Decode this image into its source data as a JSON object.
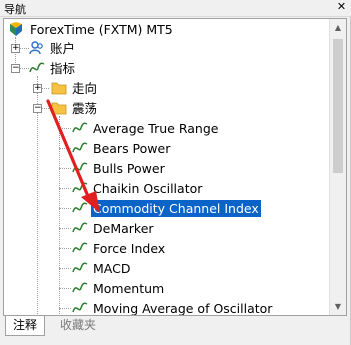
{
  "window": {
    "title": "导航"
  },
  "tree": {
    "root": {
      "label": "ForexTime (FXTM) MT5"
    },
    "accounts": {
      "label": "账户"
    },
    "indicators": {
      "label": "指标"
    },
    "trend": {
      "label": "走向"
    },
    "oscillators": {
      "label": "震荡"
    },
    "oscillator_items": [
      "Average True Range",
      "Bears Power",
      "Bulls Power",
      "Chaikin Oscillator",
      "Commodity Channel Index",
      "DeMarker",
      "Force Index",
      "MACD",
      "Momentum",
      "Moving Average of Oscillator"
    ],
    "selected_item": "Commodity Channel Index"
  },
  "tabs": [
    {
      "label": "注释",
      "active": true
    },
    {
      "label": "收藏夹",
      "active": false
    }
  ],
  "colors": {
    "selection": "#0a64c8",
    "arrow": "#e02020",
    "folder": "#f5c242",
    "indicator_icon": "#2e7d32"
  }
}
